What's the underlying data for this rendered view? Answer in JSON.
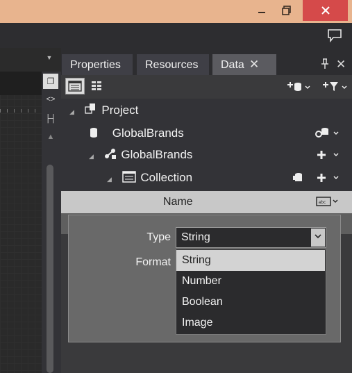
{
  "window": {
    "controls": [
      "minimize",
      "restore",
      "close"
    ]
  },
  "icons": {
    "feedback": "speech-bubble-icon",
    "pin": "pin-icon",
    "close": "close-icon"
  },
  "tabs": {
    "properties": "Properties",
    "resources": "Resources",
    "data": "Data"
  },
  "tree": {
    "project": "Project",
    "datasource": "GlobalBrands",
    "schema": "GlobalBrands",
    "collection": "Collection"
  },
  "name_header": "Name",
  "editor": {
    "type_label": "Type",
    "format_label": "Format",
    "type_value": "String",
    "options": [
      "String",
      "Number",
      "Boolean",
      "Image"
    ],
    "selected_option": "String"
  },
  "colors": {
    "titlebar": "#e8b48e",
    "close_button": "#d54a4a",
    "panel": "#3a3a3c",
    "selection": "#d3d3d3"
  }
}
